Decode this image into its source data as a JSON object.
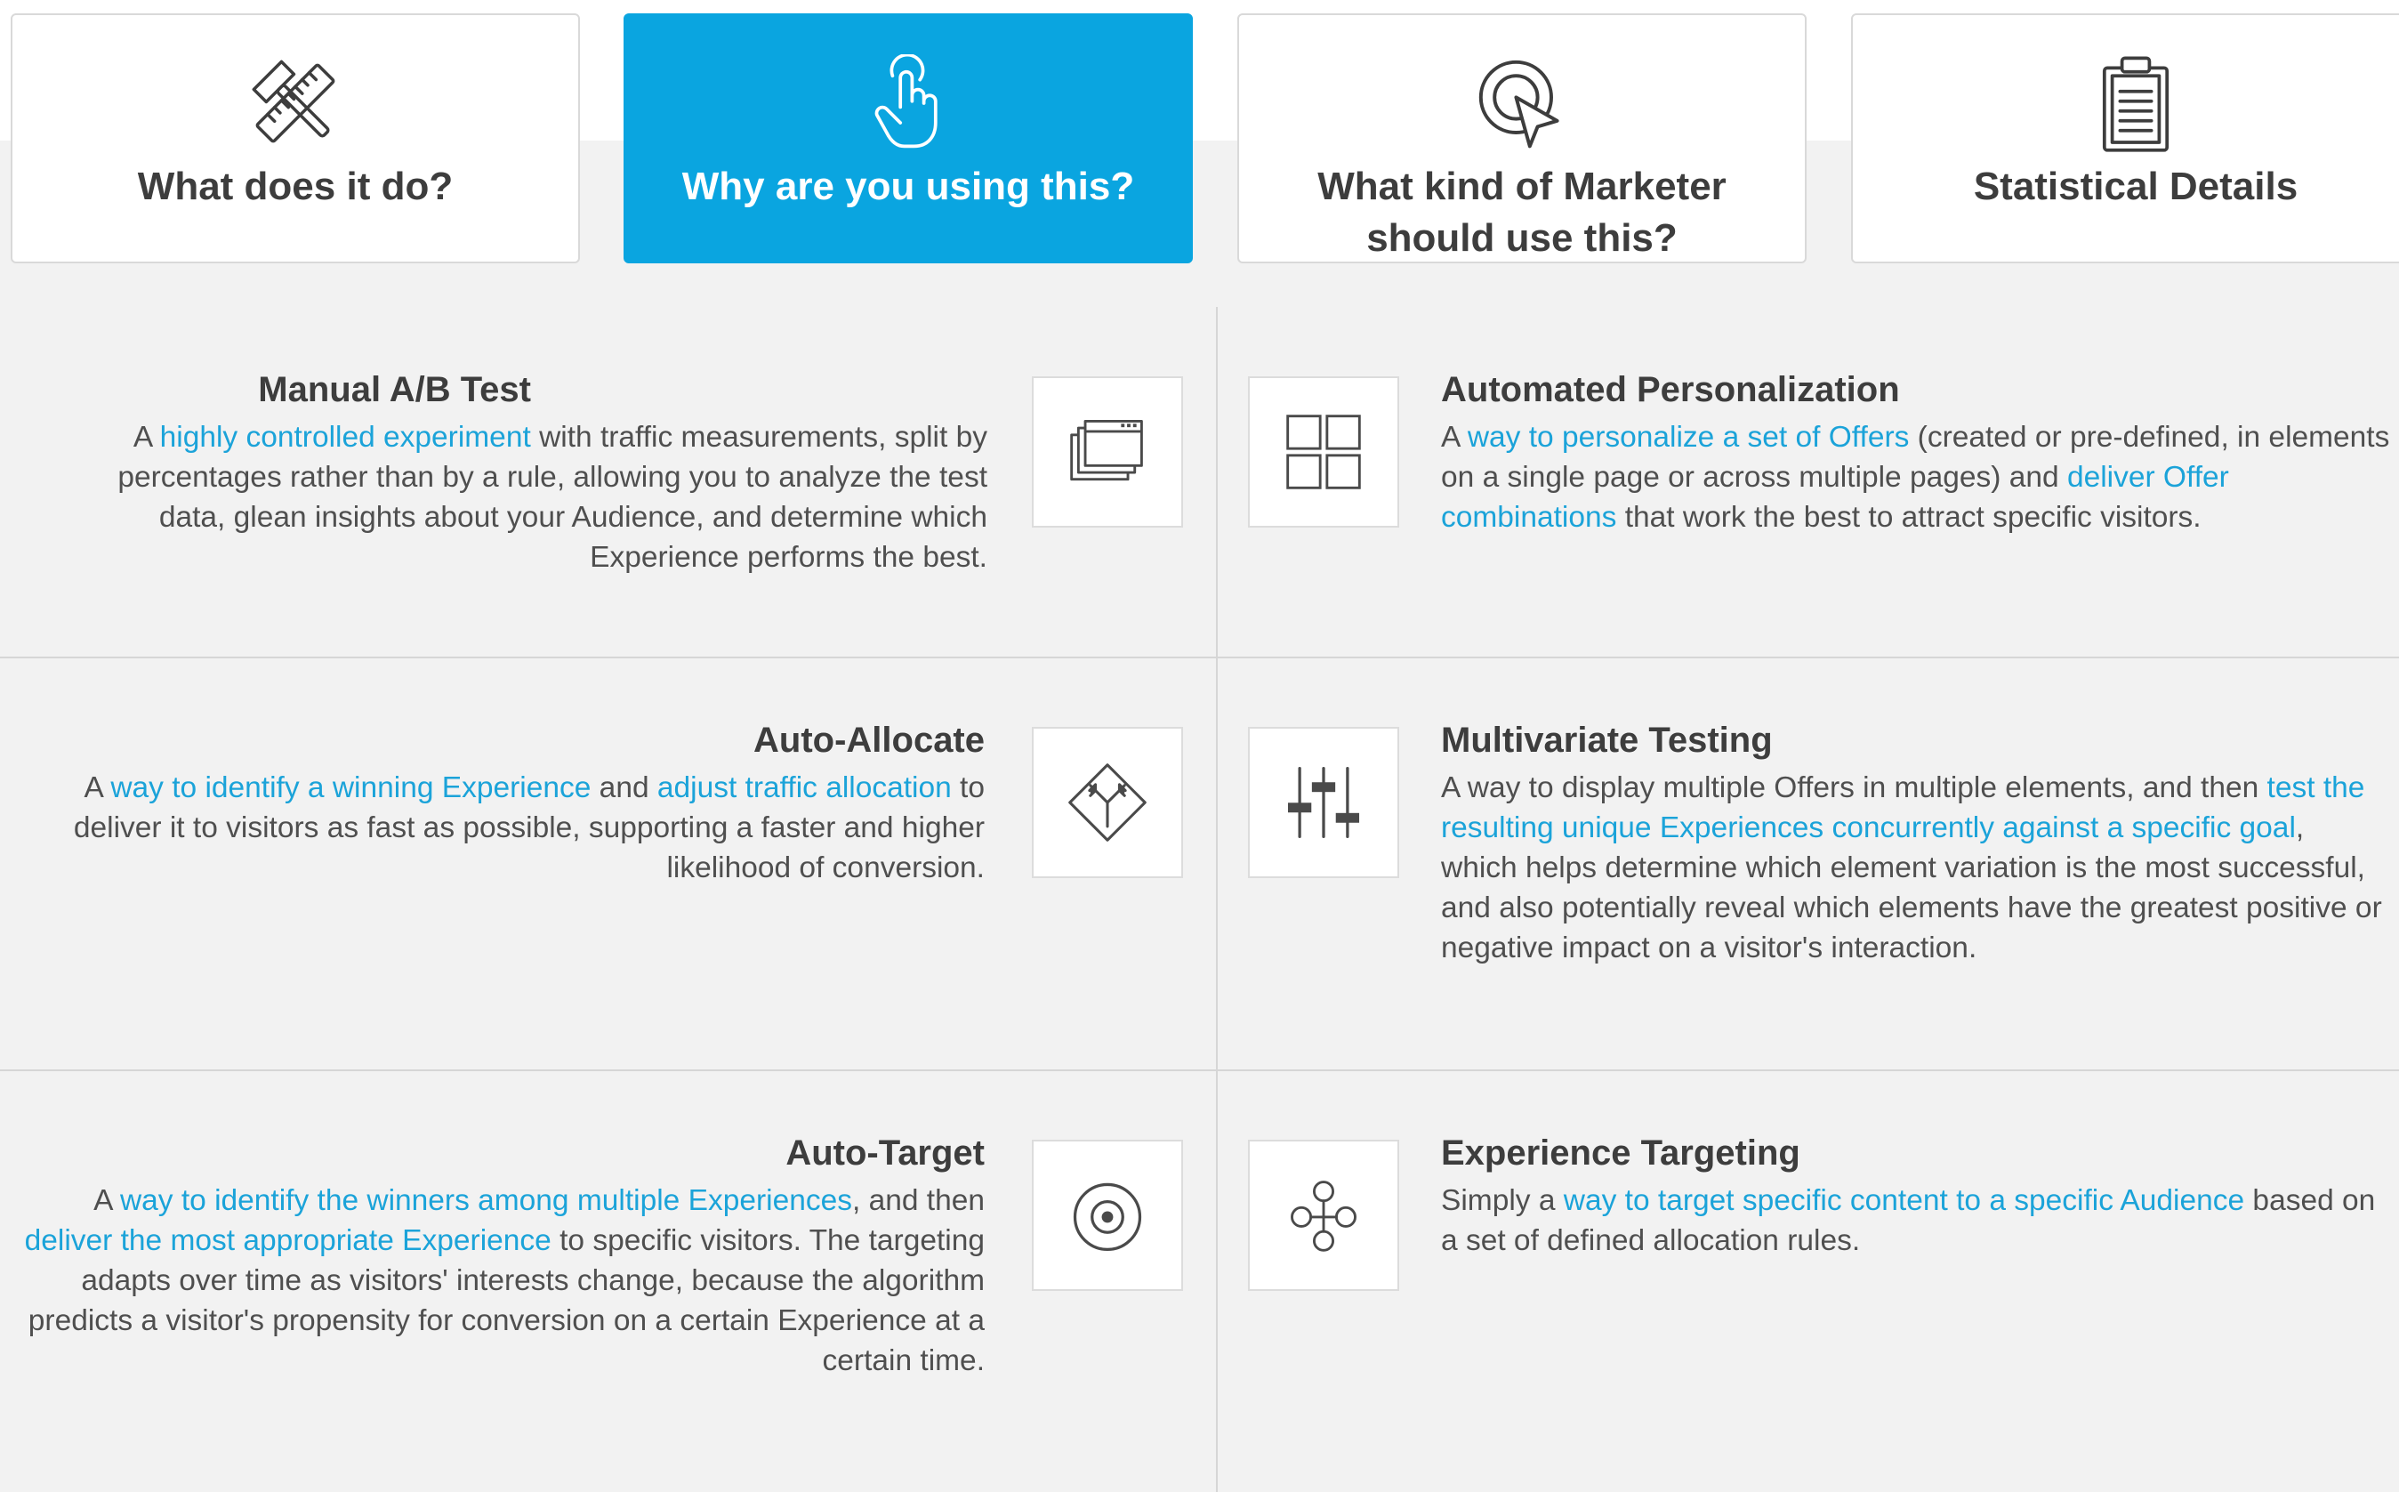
{
  "tabs": [
    {
      "label": "What does it do?",
      "icon": "tools-icon",
      "active": false
    },
    {
      "label": "Why are you using this?",
      "icon": "pointer-hand-icon",
      "active": true
    },
    {
      "label": "What kind of Marketer should use this?",
      "icon": "target-cursor-icon",
      "active": false
    },
    {
      "label": "Statistical Details",
      "icon": "clipboard-icon",
      "active": false
    }
  ],
  "activities": {
    "manual_ab": {
      "title": "Manual A/B Test",
      "icon": "windows-stack-icon",
      "d0": "A ",
      "l1": "highly controlled experiment",
      "d1": " with traffic measurements, split by percentages rather than by a rule, allowing you to analyze the test data, glean insights about your Audience, and determine which Experience performs the best."
    },
    "auto_allocate": {
      "title": "Auto-Allocate",
      "icon": "diamond-directions-icon",
      "d0": "A ",
      "l1": "way to identify a winning Experience",
      "d1": " and ",
      "l2": "adjust traffic allocation",
      "d2": " to deliver it to visitors as fast as possible, supporting a faster and  higher likelihood of conversion."
    },
    "auto_target": {
      "title": "Auto-Target",
      "icon": "target-circle-icon",
      "d0": "A ",
      "l1": "way to identify the winners among multiple Experiences",
      "d1": ", and then ",
      "l2": "deliver the most appropriate Experience",
      "d2": " to specific visitors. The targeting adapts over time as visitors' interests change, because the algorithm predicts a visitor's propensity for conversion on a certain Experience at a certain time."
    },
    "automated_personalization": {
      "title": "Automated Personalization",
      "icon": "grid-squares-icon",
      "d0": "A ",
      "l1": "way to personalize a set of Offers",
      "d1": " (created or pre-defined, in elements on a single page or across multiple pages) and ",
      "l2": "deliver Offer combinations",
      "d2": " that work the best to attract specific visitors."
    },
    "multivariate": {
      "title": "Multivariate Testing",
      "icon": "sliders-icon",
      "d0": "A way to display multiple Offers in multiple elements, and then ",
      "l1": "test the resulting unique Experiences concurrently against a specific goal",
      "d1": ", which helps determine which element variation is the most successful, and also potentially reveal which elements have the greatest positive or negative impact on a visitor's interaction."
    },
    "experience_targeting": {
      "title": "Experience Targeting",
      "icon": "flow-nodes-icon",
      "d0": "Simply a ",
      "l1": "way to target specific content to a specific Audience",
      "d1": " based on a set of defined allocation rules."
    }
  },
  "colors": {
    "accent": "#0aa5e0",
    "link": "#1ba3d9",
    "background": "#f2f2f2"
  }
}
